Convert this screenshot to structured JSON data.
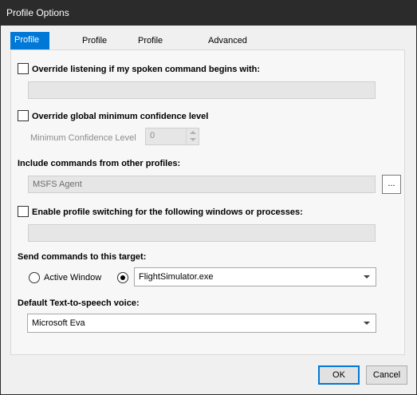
{
  "window": {
    "title": "Profile Options"
  },
  "tabs": [
    {
      "label": "Profile General",
      "active": true
    },
    {
      "label": "Profile Exec",
      "active": false
    },
    {
      "label": "Profile Hotkeys",
      "active": false
    },
    {
      "label": "Advanced",
      "active": false
    }
  ],
  "override_listening": {
    "label": "Override listening if my spoken command begins with:",
    "checked": false,
    "value": ""
  },
  "override_confidence": {
    "label": "Override global minimum confidence level",
    "checked": false,
    "min_label": "Minimum Confidence Level",
    "min_value": "0"
  },
  "include_commands": {
    "label": "Include commands from other profiles:",
    "value": "MSFS Agent",
    "browse_label": "..."
  },
  "profile_switching": {
    "label": "Enable profile switching for the following windows or processes:",
    "checked": false,
    "value": ""
  },
  "send_commands": {
    "label": "Send commands to this target:",
    "active_window_label": "Active Window",
    "selected": "process",
    "process_value": "FlightSimulator.exe"
  },
  "tts": {
    "label": "Default Text-to-speech voice:",
    "value": "Microsoft Eva"
  },
  "footer": {
    "ok_label": "OK",
    "cancel_label": "Cancel"
  },
  "colors": {
    "accent": "#0078d7",
    "titlebar": "#2b2b2b"
  }
}
